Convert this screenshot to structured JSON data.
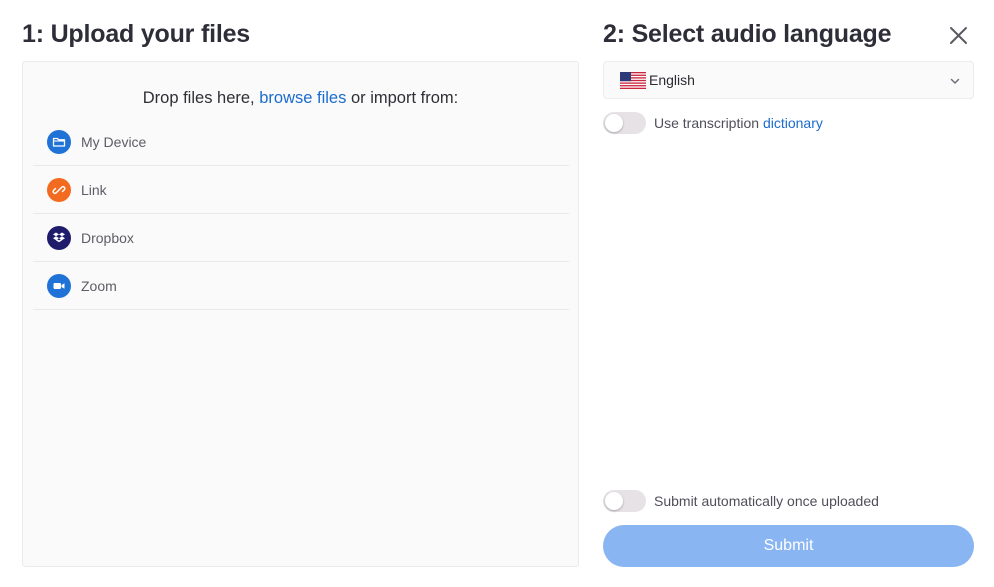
{
  "upload": {
    "title": "1: Upload your files",
    "drop_prefix": "Drop files here,",
    "browse_link": "browse files",
    "drop_suffix": "or import from:",
    "sources": [
      {
        "label": "My Device",
        "icon": "folder-icon",
        "color": "#1f72d6"
      },
      {
        "label": "Link",
        "icon": "link-icon",
        "color": "#f26b21"
      },
      {
        "label": "Dropbox",
        "icon": "dropbox-icon",
        "color": "#1f1d6b"
      },
      {
        "label": "Zoom",
        "icon": "video-camera-icon",
        "color": "#1f72d6"
      }
    ]
  },
  "language": {
    "title": "2: Select audio language",
    "selected": "English",
    "flag": "us-flag-icon"
  },
  "options": {
    "dictionary_prefix": "Use transcription",
    "dictionary_link": "dictionary",
    "dictionary_enabled": false,
    "auto_submit_label": "Submit automatically once uploaded",
    "auto_submit_enabled": false
  },
  "actions": {
    "submit_label": "Submit"
  },
  "colors": {
    "link": "#1b6ccf",
    "submit_bg": "#8ab5f3",
    "toggle_off": "#e6e2e6"
  }
}
